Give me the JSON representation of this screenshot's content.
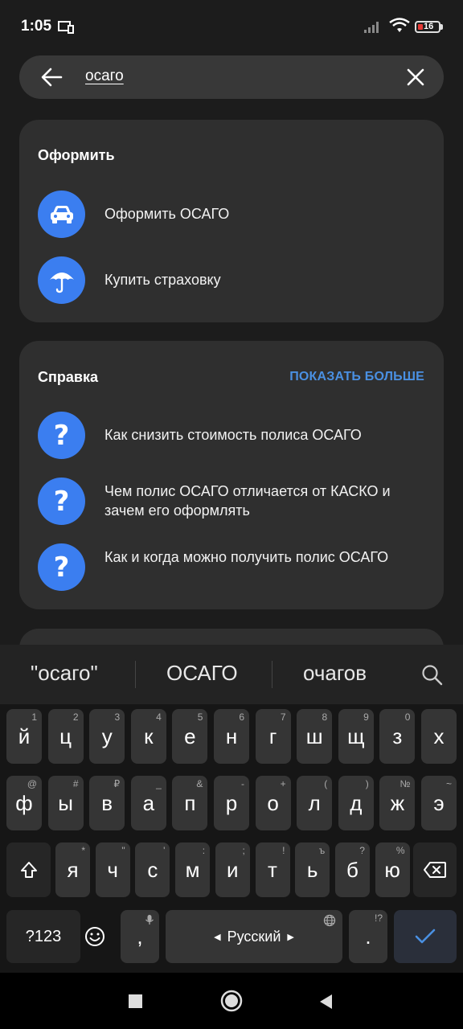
{
  "status": {
    "time": "1:05",
    "battery": "16"
  },
  "search": {
    "query": "осаго"
  },
  "card1": {
    "title": "Оформить",
    "items": [
      {
        "label": "Оформить ОСАГО",
        "icon": "car-icon"
      },
      {
        "label": "Купить страховку",
        "icon": "umbrella-icon"
      }
    ]
  },
  "card2": {
    "title": "Справка",
    "more": "ПОКАЗАТЬ БОЛЬШЕ",
    "items": [
      {
        "label": "Как снизить стоимость полиса ОСАГО",
        "icon": "question-icon"
      },
      {
        "label": "Чем полис ОСАГО отличается от КАСКО и зачем его оформлять",
        "icon": "question-icon"
      },
      {
        "label": "Как и когда можно получить полис ОСАГО",
        "icon": "question-icon"
      }
    ],
    "qmark": "?"
  },
  "suggestions": [
    "\"осаго\"",
    "ОСАГО",
    "очагов"
  ],
  "keyboard": {
    "row1": [
      [
        "й",
        "1"
      ],
      [
        "ц",
        "2"
      ],
      [
        "у",
        "3"
      ],
      [
        "к",
        "4"
      ],
      [
        "е",
        "5"
      ],
      [
        "н",
        "6"
      ],
      [
        "г",
        "7"
      ],
      [
        "ш",
        "8"
      ],
      [
        "щ",
        "9"
      ],
      [
        "з",
        "0"
      ],
      [
        "х",
        ""
      ]
    ],
    "row2": [
      [
        "ф",
        "@"
      ],
      [
        "ы",
        "#"
      ],
      [
        "в",
        "₽"
      ],
      [
        "а",
        "_"
      ],
      [
        "п",
        "&"
      ],
      [
        "р",
        "-"
      ],
      [
        "о",
        "+"
      ],
      [
        "л",
        "("
      ],
      [
        "д",
        ")"
      ],
      [
        "ж",
        "№"
      ],
      [
        "э",
        "~"
      ]
    ],
    "row3": [
      [
        "я",
        "*"
      ],
      [
        "ч",
        "\""
      ],
      [
        "с",
        "'"
      ],
      [
        "м",
        ":"
      ],
      [
        "и",
        ";"
      ],
      [
        "т",
        "!"
      ],
      [
        "ь",
        "ъ"
      ],
      [
        "б",
        "?"
      ],
      [
        "ю",
        "%"
      ]
    ],
    "symbols_label": "?123",
    "comma": ",",
    "space_label": "Русский",
    "period": ".",
    "period_hint": "!?"
  },
  "colors": {
    "accent": "#3b7ef0",
    "link": "#4a90e2",
    "card": "#2f2f2f",
    "background": "#1c1c1c"
  }
}
